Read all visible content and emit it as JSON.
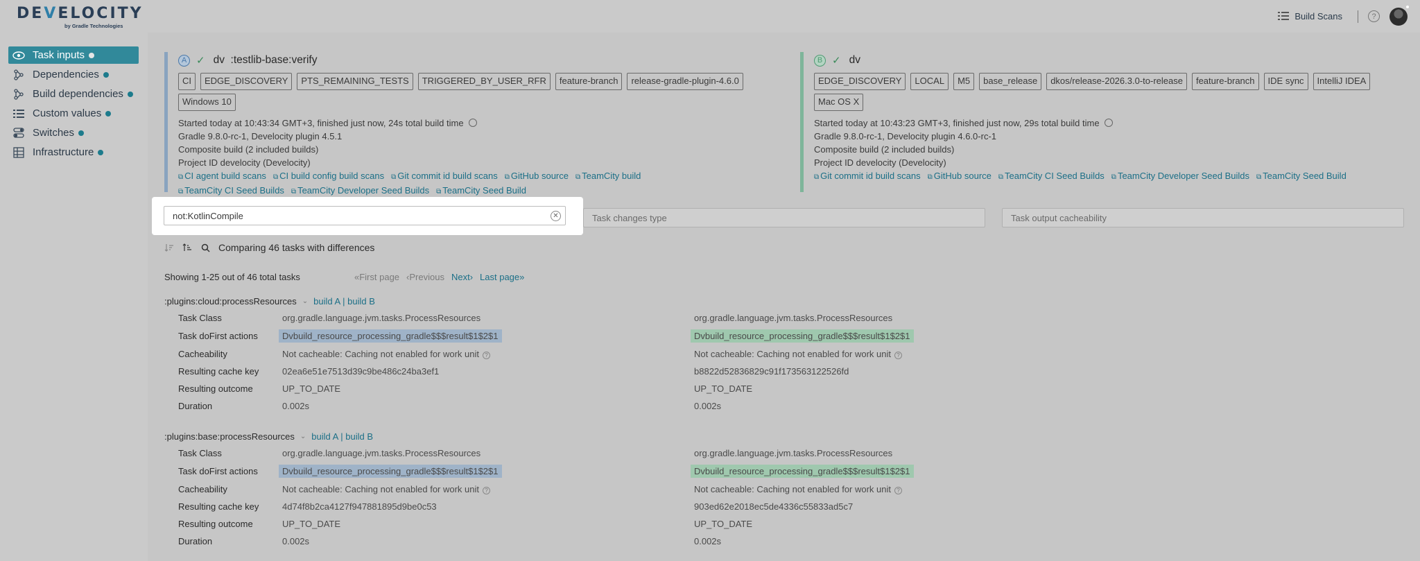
{
  "header": {
    "logo_text": "DEVELOCITY",
    "logo_sub": "by Gradle Technologies",
    "build_scans_label": "Build Scans",
    "help_label": "?"
  },
  "sidebar": {
    "items": [
      {
        "label": "Task inputs",
        "icon": "eye-icon",
        "active": true
      },
      {
        "label": "Dependencies",
        "icon": "tree-icon"
      },
      {
        "label": "Build dependencies",
        "icon": "tree-icon"
      },
      {
        "label": "Custom values",
        "icon": "list-icon"
      },
      {
        "label": "Switches",
        "icon": "toggle-icon"
      },
      {
        "label": "Infrastructure",
        "icon": "server-icon"
      }
    ]
  },
  "build_a": {
    "badge": "A",
    "title": "dv  :testlib-base:verify",
    "tags": [
      "CI",
      "EDGE_DISCOVERY",
      "PTS_REMAINING_TESTS",
      "TRIGGERED_BY_USER_RFR",
      "feature-branch",
      "release-gradle-plugin-4.6.0",
      "Windows 10"
    ],
    "started": "Started today at 10:43:34 GMT+3, finished just now, 24s total build time",
    "gradle": "Gradle 9.8.0-rc-1, Develocity plugin 4.5.1",
    "composite": "Composite build (2 included builds)",
    "project": "Project ID develocity (Develocity)",
    "links": [
      "CI agent build scans",
      "CI build config build scans",
      "Git commit id build scans",
      "GitHub source",
      "TeamCity build",
      "TeamCity CI Seed Builds",
      "TeamCity Developer Seed Builds",
      "TeamCity Seed Build"
    ]
  },
  "build_b": {
    "badge": "B",
    "title": "dv",
    "tags": [
      "EDGE_DISCOVERY",
      "LOCAL",
      "M5",
      "base_release",
      "dkos/release-2026.3.0-to-release",
      "feature-branch",
      "IDE sync",
      "IntelliJ IDEA",
      "Mac OS X"
    ],
    "started": "Started today at 10:43:23 GMT+3, finished just now, 29s total build time",
    "gradle": "Gradle 9.8.0-rc-1, Develocity plugin 4.6.0-rc-1",
    "composite": "Composite build (2 included builds)",
    "project": "Project ID develocity (Develocity)",
    "links": [
      "Git commit id build scans",
      "GitHub source",
      "TeamCity CI Seed Builds",
      "TeamCity Developer Seed Builds",
      "TeamCity Seed Build"
    ]
  },
  "filters": {
    "task_filter_value": "not:KotlinCompile",
    "changes_type_placeholder": "Task changes type",
    "cacheability_placeholder": "Task output cacheability"
  },
  "comparing": "Comparing 46 tasks with differences",
  "showing": "Showing 1-25 out of 46 total tasks",
  "pager": {
    "first": "«First page",
    "prev": "‹Previous",
    "next": "Next›",
    "last": "Last page»"
  },
  "tasks": [
    {
      "name": ":plugins:cloud:processResources",
      "build_a_link": "build A",
      "sep": "|",
      "build_b_link": "build B",
      "rows": [
        {
          "label": "Task Class",
          "a": "org.gradle.language.jvm.tasks.ProcessResources",
          "b": "org.gradle.language.jvm.tasks.ProcessResources"
        },
        {
          "label": "Task doFirst actions",
          "a": "Dvbuild_resource_processing_gradle$$$result$1$2$1",
          "b": "Dvbuild_resource_processing_gradle$$$result$1$2$1"
        },
        {
          "label": "Cacheability",
          "a": "Not cacheable: Caching not enabled for work unit",
          "b": "Not cacheable: Caching not enabled for work unit"
        },
        {
          "label": "Resulting cache key",
          "a": "02ea6e51e7513d39c9be486c24ba3ef1",
          "b": "b8822d52836829c91f173563122526fd"
        },
        {
          "label": "Resulting outcome",
          "a": "UP_TO_DATE",
          "b": "UP_TO_DATE"
        },
        {
          "label": "Duration",
          "a": "0.002s",
          "b": "0.002s"
        }
      ]
    },
    {
      "name": ":plugins:base:processResources",
      "build_a_link": "build A",
      "sep": "|",
      "build_b_link": "build B",
      "rows": [
        {
          "label": "Task Class",
          "a": "org.gradle.language.jvm.tasks.ProcessResources",
          "b": "org.gradle.language.jvm.tasks.ProcessResources"
        },
        {
          "label": "Task doFirst actions",
          "a": "Dvbuild_resource_processing_gradle$$$result$1$2$1",
          "b": "Dvbuild_resource_processing_gradle$$$result$1$2$1"
        },
        {
          "label": "Cacheability",
          "a": "Not cacheable: Caching not enabled for work unit",
          "b": "Not cacheable: Caching not enabled for work unit"
        },
        {
          "label": "Resulting cache key",
          "a": "4d74f8b2ca4127f947881895d9be0c53",
          "b": "903ed62e2018ec5de4336c55833ad5c7"
        },
        {
          "label": "Resulting outcome",
          "a": "UP_TO_DATE",
          "b": "UP_TO_DATE"
        },
        {
          "label": "Duration",
          "a": "0.002s",
          "b": "0.002s"
        }
      ]
    }
  ]
}
